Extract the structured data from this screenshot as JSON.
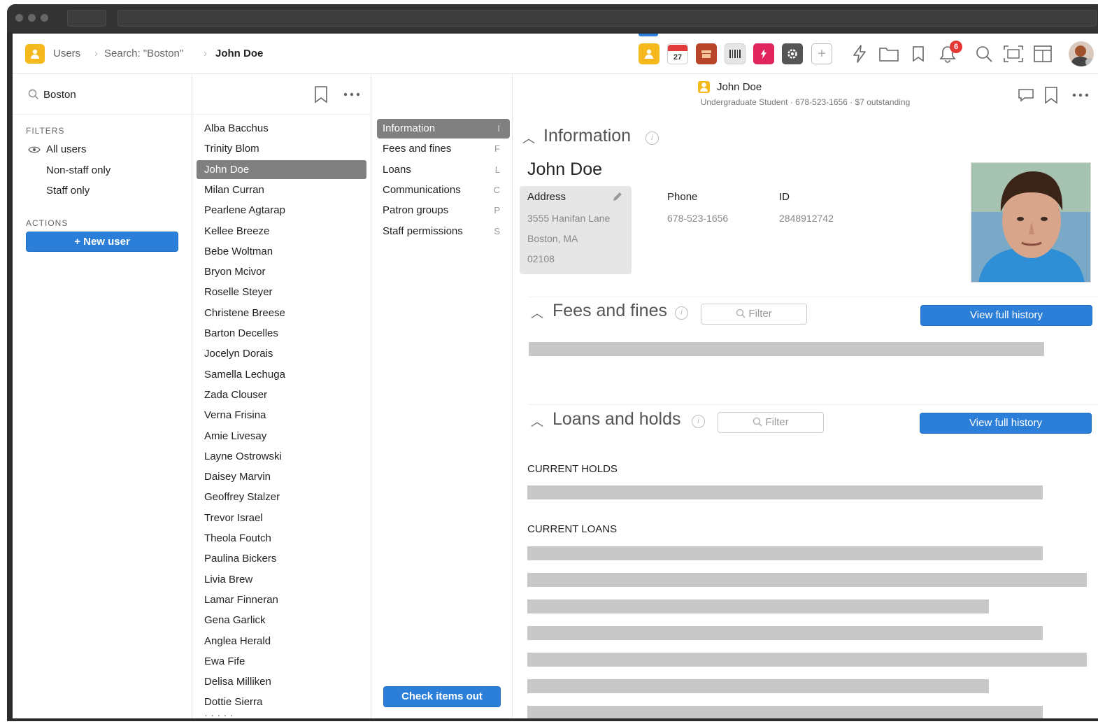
{
  "breadcrumb": {
    "app": "Users",
    "search": "Search: \"Boston\"",
    "current": "John Doe"
  },
  "toolbar": {
    "calendar_day": "27",
    "notification_count": "6"
  },
  "search": {
    "value": "Boston"
  },
  "filters": {
    "label": "FILTERS",
    "items": [
      "All users",
      "Non-staff only",
      "Staff only"
    ]
  },
  "actions": {
    "label": "ACTIONS",
    "new_user": "+ New user"
  },
  "users": [
    "Alba Bacchus",
    "Trinity Blom",
    "John Doe",
    "Milan Curran",
    "Pearlene Agtarap",
    "Kellee Breeze",
    "Bebe Woltman",
    "Bryon Mcivor",
    "Roselle Steyer",
    "Christene Breese",
    "Barton Decelles",
    "Jocelyn Dorais",
    "Samella Lechuga",
    "Zada Clouser",
    "Verna Frisina",
    "Amie Livesay",
    "Layne Ostrowski",
    "Daisey Marvin",
    "Geoffrey Stalzer",
    "Trevor Israel",
    "Theola Foutch",
    "Paulina Bickers",
    "Livia Brew",
    "Lamar Finneran",
    "Gena Garlick",
    "Anglea Herald",
    "Ewa Fife",
    "Delisa Milliken",
    "Dottie Sierra"
  ],
  "nav": [
    {
      "label": "Information",
      "key": "I"
    },
    {
      "label": "Fees and fines",
      "key": "F"
    },
    {
      "label": "Loans",
      "key": "L"
    },
    {
      "label": "Communications",
      "key": "C"
    },
    {
      "label": "Patron groups",
      "key": "P"
    },
    {
      "label": "Staff permissions",
      "key": "S"
    }
  ],
  "check_out": "Check items out",
  "record": {
    "title": "John Doe",
    "subtitle": "Undergraduate Student · 678-523-1656 · $7 outstanding",
    "info_heading": "Information",
    "name": "John Doe",
    "address_label": "Address",
    "address_lines": [
      "3555 Hanifan Lane",
      "Boston, MA",
      "02108"
    ],
    "phone_label": "Phone",
    "phone": "678-523-1656",
    "id_label": "ID",
    "id": "2848912742",
    "fees_heading": "Fees and fines",
    "loans_heading": "Loans and holds",
    "filter_placeholder": "Filter",
    "view_history": "View full history",
    "current_holds": "CURRENT HOLDS",
    "current_loans": "CURRENT LOANS"
  },
  "colors": {
    "accent": "#2b7fd8",
    "selected": "#808080",
    "users_icon": "#f5b91d"
  }
}
